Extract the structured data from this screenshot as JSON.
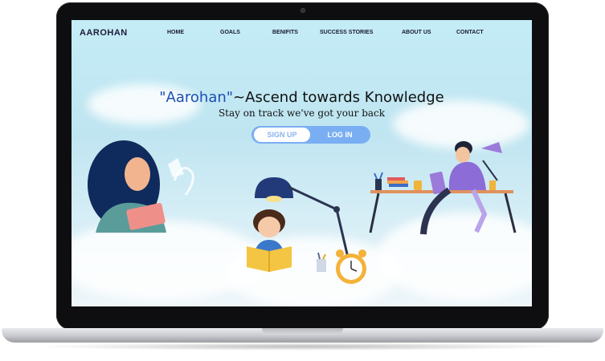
{
  "nav": {
    "brand": "AAROHAN",
    "items": [
      {
        "label": "HOME"
      },
      {
        "label": "GOALS"
      },
      {
        "label": "BENIFITS"
      },
      {
        "label": "SUCCESS  STORIES"
      },
      {
        "label": "ABOUT US"
      },
      {
        "label": "CONTACT"
      }
    ]
  },
  "hero": {
    "headline_quoted": "\"Aarohan\"",
    "headline_rest": "~Ascend towards Knowledge",
    "subline": "Stay on track we've got your back",
    "signup_label": "SIGN UP",
    "login_label": "LOG IN"
  },
  "colors": {
    "accent": "#1d4fb3",
    "button_pill": "#7aaef2",
    "sky": "#c4ecf6"
  },
  "illustrations": [
    "woman-reading-illustration",
    "girl-reading-book-illustration",
    "desk-lamp-illustration",
    "alarm-clock-illustration",
    "man-studying-at-desk-illustration"
  ]
}
